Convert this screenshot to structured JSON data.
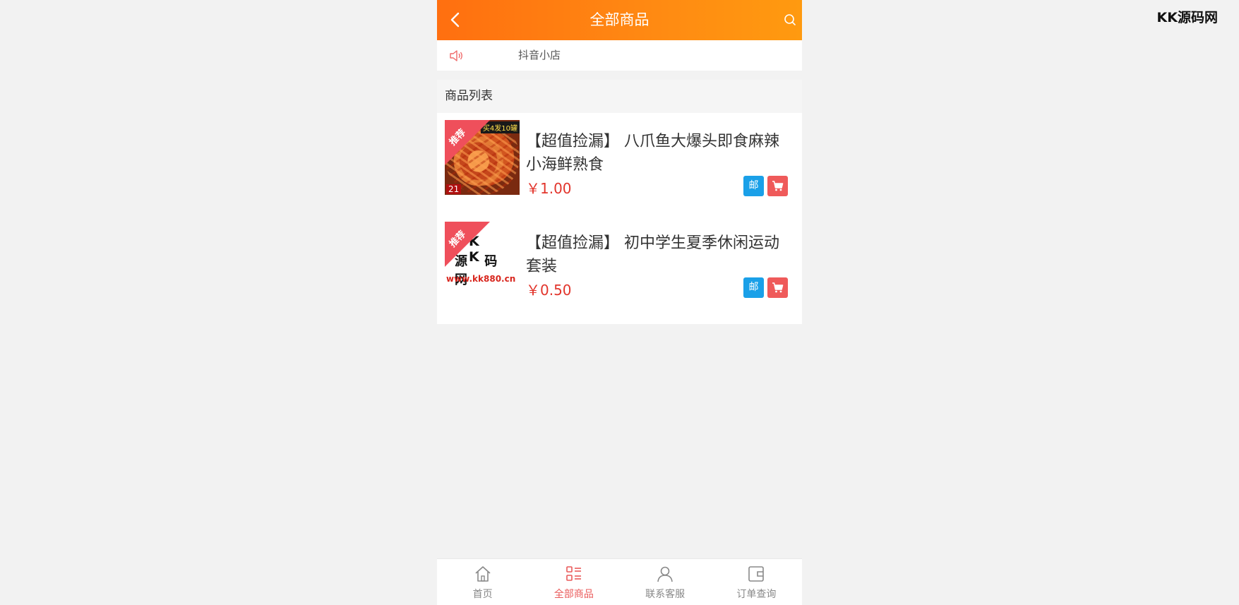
{
  "watermark": "KK源码网",
  "header": {
    "title": "全部商品"
  },
  "notice": {
    "text": "抖音小店"
  },
  "list": {
    "title": "商品列表",
    "items": [
      {
        "badge": "推荐",
        "name": "【超值捡漏】 八爪鱼大爆头即食麻辣小海鲜熟食",
        "price": "￥1.00",
        "thumb_text": {
          "promo": "买4发10罐",
          "num": "21"
        },
        "mail_label": "邮"
      },
      {
        "badge": "推荐",
        "name": "【超值捡漏】 初中学生夏季休闲运动套装",
        "price": "￥0.50",
        "thumb_text": {
          "kk": "K K",
          "cn": "源 码 网",
          "url": "www.kk880.cn"
        },
        "mail_label": "邮"
      }
    ]
  },
  "tabbar": {
    "tabs": [
      {
        "label": "首页",
        "icon": "home-icon"
      },
      {
        "label": "全部商品",
        "icon": "list-icon",
        "active": true
      },
      {
        "label": "联系客服",
        "icon": "user-icon"
      },
      {
        "label": "订单查询",
        "icon": "wallet-icon"
      }
    ]
  },
  "colors": {
    "header_start": "#ff6f10",
    "header_end": "#ff9a10",
    "price": "#e2352c",
    "mail_button": "#1aa0e8",
    "cart_button": "#ef5a5a",
    "active_tab": "#ea5a5a"
  }
}
